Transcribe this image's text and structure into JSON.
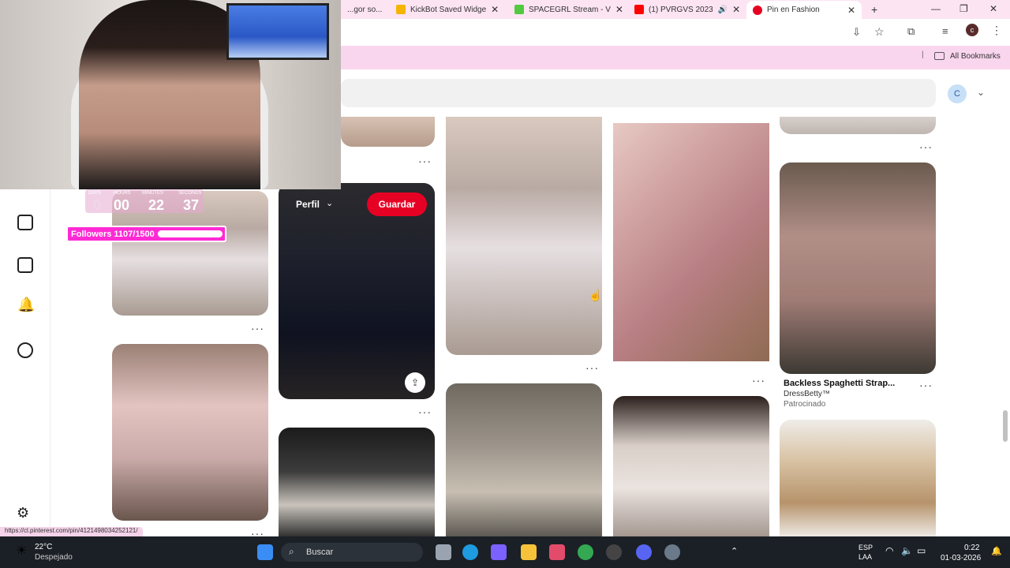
{
  "browser": {
    "tabs": [
      {
        "title": "...gor so...",
        "favicon_color": "#e94b9a"
      },
      {
        "title": "KickBot Saved Widge",
        "favicon_color": "#f5b400"
      },
      {
        "title": "SPACEGRL Stream - V",
        "favicon_color": "#53c940"
      },
      {
        "title": "(1) PVRGVS 2023",
        "favicon_color": "#ff0000"
      },
      {
        "title": "Pin en Fashion",
        "favicon_color": "#e60023",
        "active": true
      }
    ],
    "bookmarks_label": "All Bookmarks",
    "profile_initial": "c",
    "status_url": "https://cl.pinterest.com/pin/4121498034252121/"
  },
  "pinterest": {
    "user_initial": "C",
    "profile_button": "Perfil",
    "save_button": "Guardar",
    "sponsored_pin": {
      "title": "Backless Spaghetti Strap...",
      "advertiser": "DressBetty™",
      "label": "Patrocinado"
    },
    "more_label": "···"
  },
  "stream_overlay": {
    "countdown": {
      "labels": [
        "DAYS",
        "HOURS",
        "MINUTES",
        "SECONDS"
      ],
      "values": [
        "0",
        "00",
        "22",
        "37"
      ]
    },
    "followers": {
      "text": "Followers 1107/1500",
      "progress": 0.738
    }
  },
  "taskbar": {
    "weather_temp": "22°C",
    "weather_desc": "Despejado",
    "search_label": "Buscar",
    "lang_top": "ESP",
    "lang_bottom": "LAA",
    "time": "0:22",
    "date": "01-03-2026"
  },
  "colors": {
    "pinterest_red": "#e60023",
    "accent_pink": "#ff2ad4",
    "bookmarks_bg": "#fad6ee"
  }
}
